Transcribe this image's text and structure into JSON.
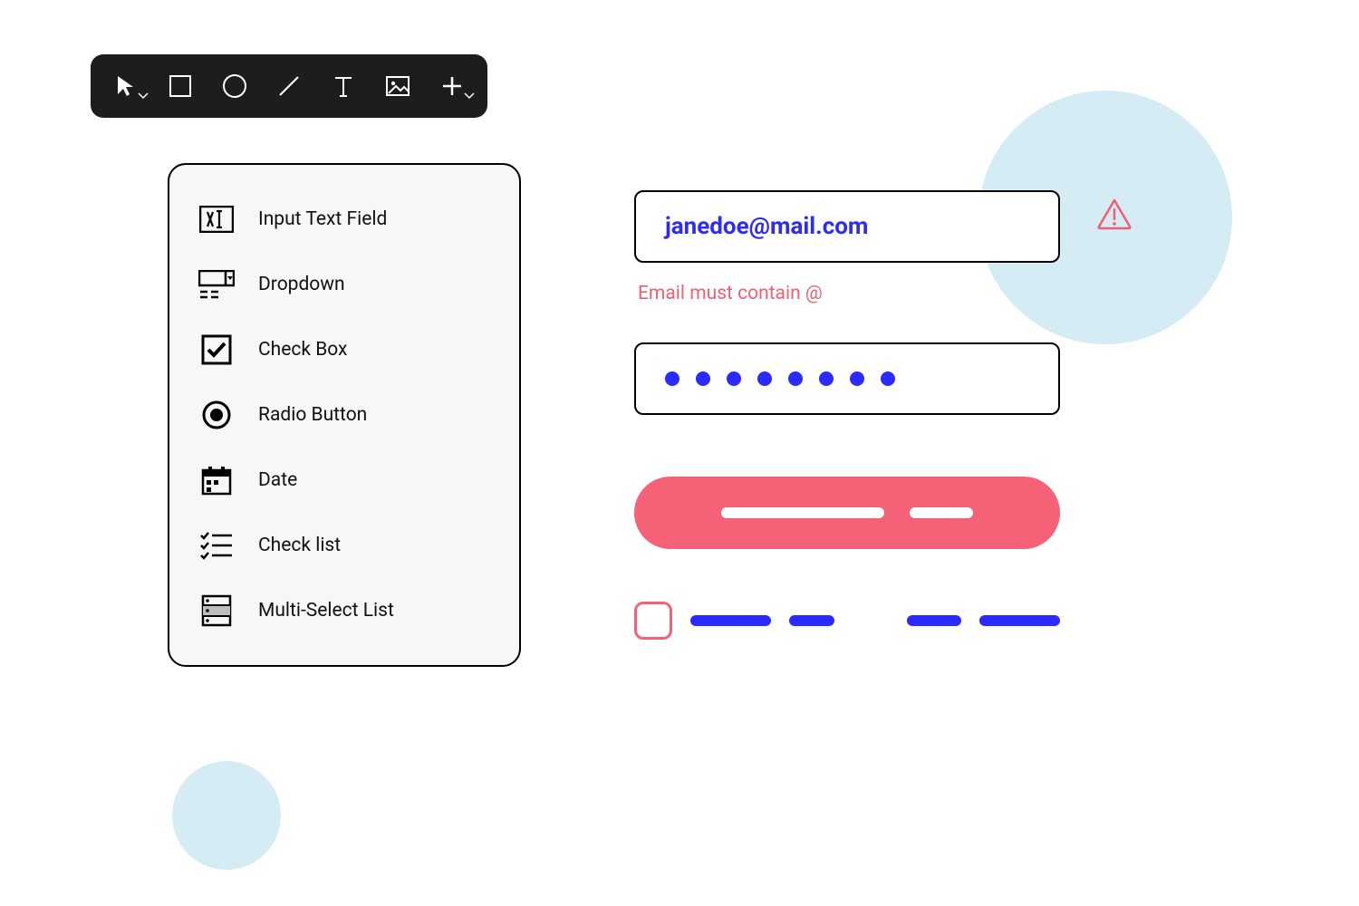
{
  "toolbar": {
    "tools": [
      "pointer",
      "rectangle",
      "circle",
      "line",
      "text",
      "image",
      "add"
    ]
  },
  "panel": {
    "items": [
      {
        "icon": "input-text-icon",
        "label": "Input Text Field"
      },
      {
        "icon": "dropdown-icon",
        "label": "Dropdown"
      },
      {
        "icon": "checkbox-icon",
        "label": "Check Box"
      },
      {
        "icon": "radio-icon",
        "label": "Radio Button"
      },
      {
        "icon": "date-icon",
        "label": "Date"
      },
      {
        "icon": "checklist-icon",
        "label": "Check list"
      },
      {
        "icon": "multiselect-icon",
        "label": "Multi-Select List"
      }
    ]
  },
  "form": {
    "email_value": "janedoe@mail.com",
    "email_error": "Email must contain @",
    "password_mask_count": 8
  },
  "colors": {
    "accent_blue": "#2b2bff",
    "error_pink": "#f56277",
    "soft_blue": "#d6ecf5"
  }
}
